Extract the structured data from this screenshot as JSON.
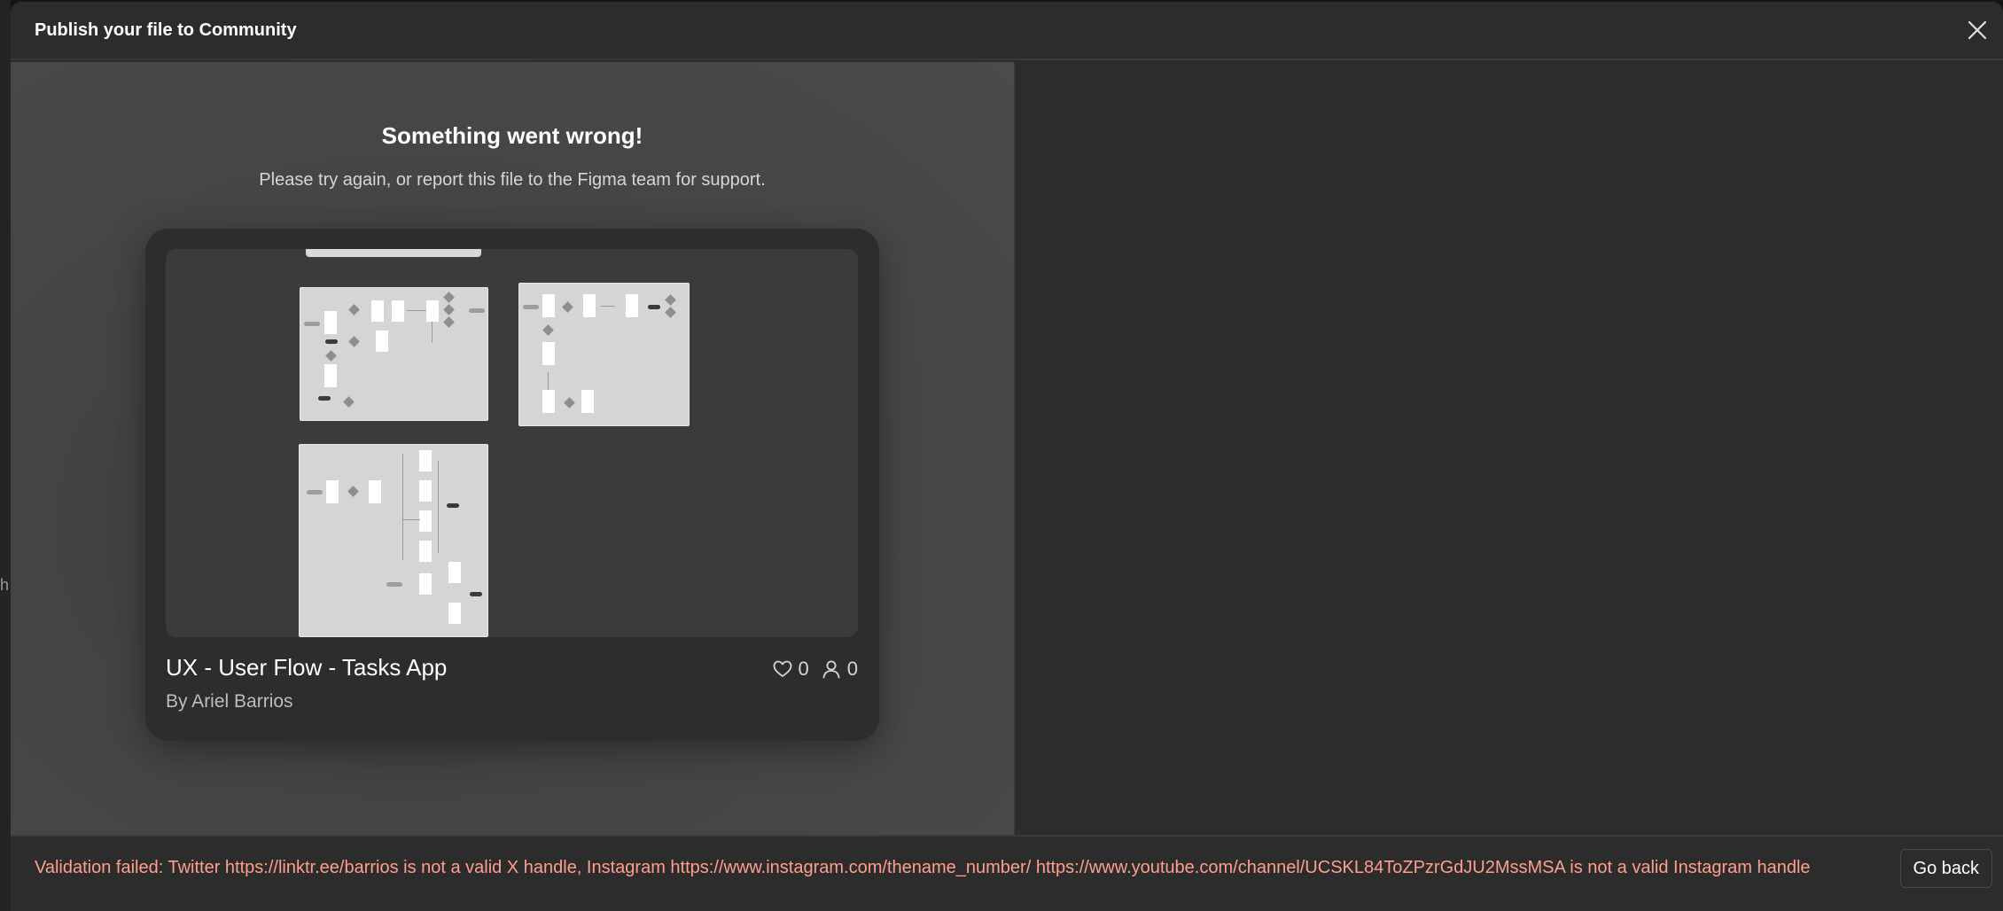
{
  "dialog": {
    "title": "Publish your file to Community"
  },
  "error": {
    "title": "Something went wrong!",
    "message": "Please try again, or report this file to the Figma team for support."
  },
  "file_card": {
    "name": "UX - User Flow - Tasks App",
    "author": "By Ariel Barrios",
    "likes": "0",
    "users": "0",
    "icons": [
      "heart-icon",
      "user-icon"
    ]
  },
  "footer": {
    "validation_message": "Validation failed: Twitter https://linktr.ee/barrios is not a valid X handle, Instagram https://www.instagram.com/thename_number/ https://www.youtube.com/channel/UCSKL84ToZPzrGdJU2MssMSA is not a valid Instagram handle",
    "go_back_label": "Go back"
  },
  "background": {
    "edge_fragment": "h"
  },
  "colors": {
    "error_text": "#ff9f8c",
    "modal_bg": "#2c2c2c",
    "preview_bg": "#444444"
  }
}
